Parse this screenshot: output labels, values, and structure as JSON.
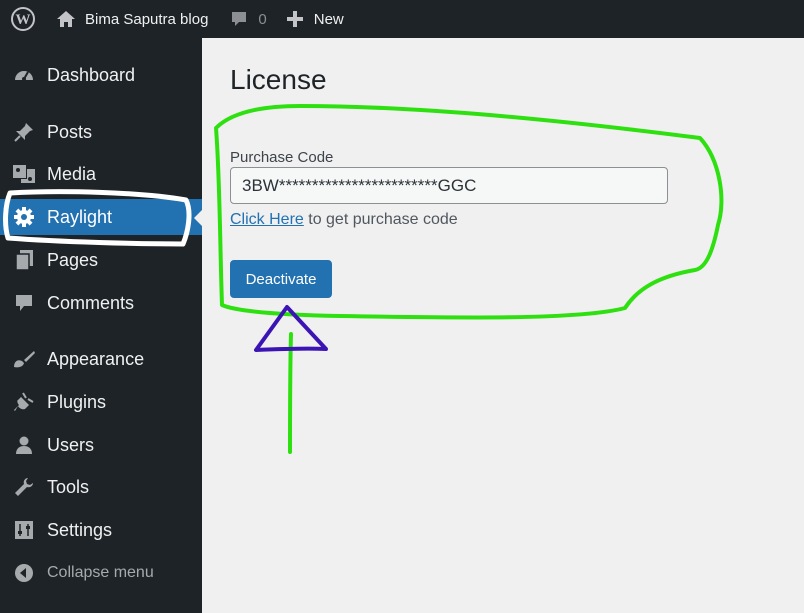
{
  "adminbar": {
    "site_name": "Bima Saputra blog",
    "comments_count": "0",
    "new_label": "New"
  },
  "sidebar": {
    "items": [
      {
        "label": "Dashboard",
        "icon": "dashboard-icon"
      },
      {
        "label": "Posts",
        "icon": "pushpin-icon"
      },
      {
        "label": "Media",
        "icon": "media-icon"
      },
      {
        "label": "Raylight",
        "icon": "gear-icon",
        "current": true
      },
      {
        "label": "Pages",
        "icon": "pages-icon"
      },
      {
        "label": "Comments",
        "icon": "comment-icon"
      },
      {
        "label": "Appearance",
        "icon": "paintbrush-icon"
      },
      {
        "label": "Plugins",
        "icon": "plug-icon"
      },
      {
        "label": "Users",
        "icon": "user-icon"
      },
      {
        "label": "Tools",
        "icon": "wrench-icon"
      },
      {
        "label": "Settings",
        "icon": "settings-icon"
      }
    ],
    "collapse_label": "Collapse menu"
  },
  "main": {
    "title": "License",
    "purchase_code_label": "Purchase Code",
    "purchase_code_value": "3BW************************GGC",
    "help_link": "Click Here",
    "help_text": " to get purchase code",
    "deactivate_label": "Deactivate"
  },
  "colors": {
    "admin_bg": "#1d2327",
    "accent": "#2271b1",
    "annotation_green": "#2fe010",
    "annotation_purple": "#3c14b4",
    "annotation_white": "#ffffff"
  }
}
